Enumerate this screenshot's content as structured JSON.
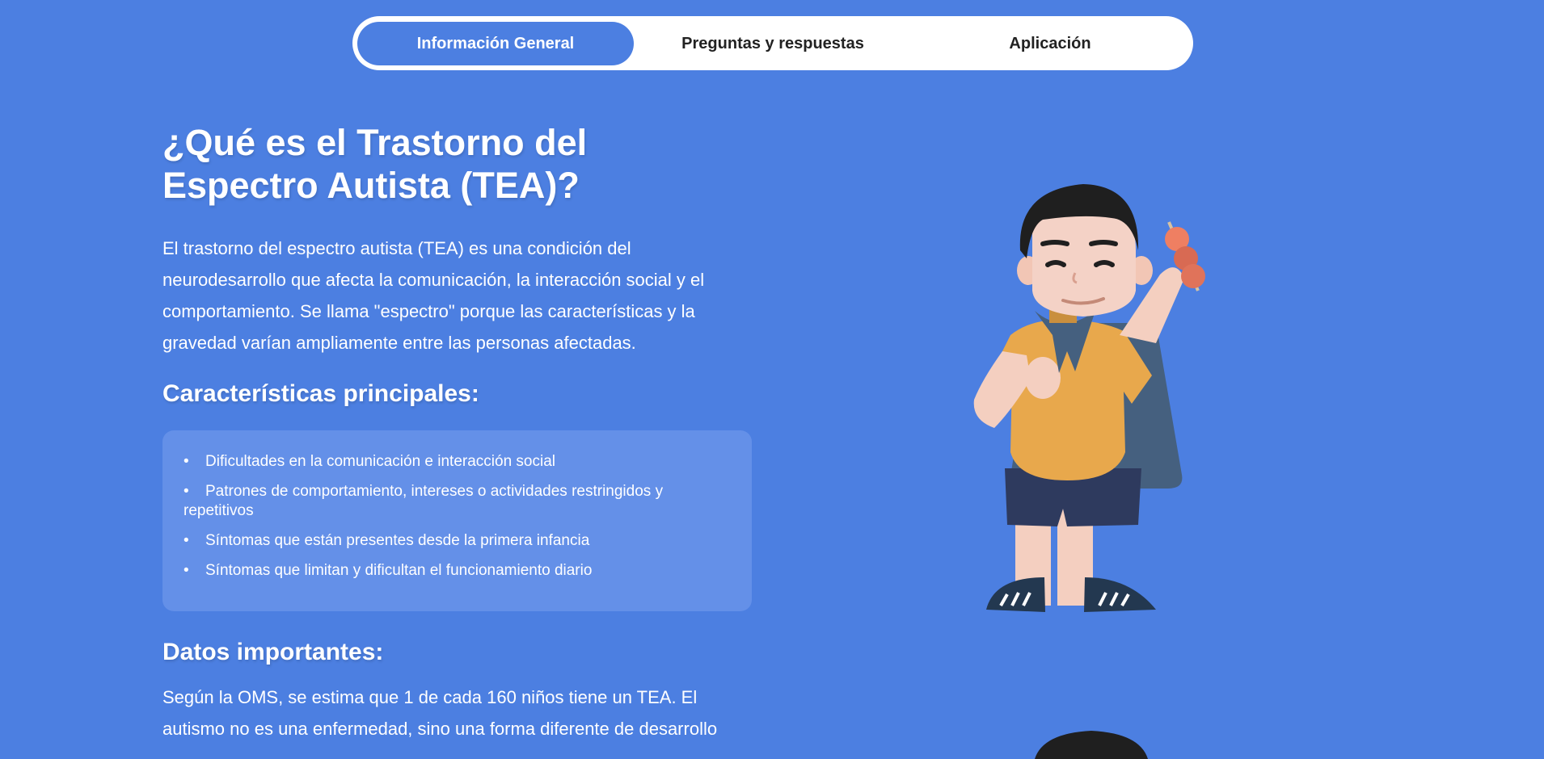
{
  "tabs": [
    {
      "label": "Información General",
      "active": true
    },
    {
      "label": "Preguntas y respuestas",
      "active": false
    },
    {
      "label": "Aplicación",
      "active": false
    }
  ],
  "main": {
    "title": "¿Qué es el Trastorno del Espectro Autista (TEA)?",
    "intro": "El trastorno del espectro autista (TEA) es una condición del neurodesarrollo que afecta la comunicación, la interacción social y el comportamiento. Se llama \"espectro\" porque las características y la gravedad varían ampliamente entre las personas afectadas.",
    "features_heading": "Características principales:",
    "features": [
      "Dificultades en la comunicación e interacción social",
      "Patrones de comportamiento, intereses o actividades restringidos y repetitivos",
      "Síntomas que están presentes desde la primera infancia",
      "Síntomas que limitan y dificultan el funcionamiento diario"
    ],
    "facts_heading": "Datos importantes:",
    "facts": "Según la OMS, se estima que 1 de cada 160 niños tiene un TEA. El autismo no es una enfermedad, sino una forma diferente de desarrollo"
  },
  "colors": {
    "background": "#4c7fe1",
    "tab_active": "#4c7fe1",
    "tab_bar": "#ffffff",
    "feature_box": "#6490e8"
  },
  "icons": [
    "boy-eating-skewer-illustration",
    "second-character-illustration"
  ]
}
